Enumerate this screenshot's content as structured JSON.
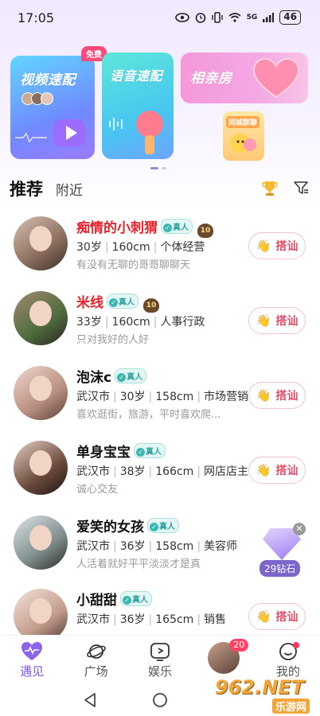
{
  "status_bar": {
    "time": "17:05",
    "signal": "5G",
    "battery": "46"
  },
  "banners": {
    "video_match": {
      "title": "视频速配",
      "badge": "免费"
    },
    "voice_match": {
      "title": "语音速配"
    },
    "blind_date": {
      "title": "相亲房"
    },
    "city_group": {
      "title": "同城群聊"
    }
  },
  "tabs": {
    "recommend": "推荐",
    "nearby": "附近"
  },
  "real_label": "真人",
  "greet_label": "搭讪",
  "users": [
    {
      "name": "痴情的小刺猬",
      "name_red": true,
      "real": true,
      "level": "10",
      "city": "",
      "age": "30岁",
      "height": "160cm",
      "job": "个体经营",
      "bio": "有没有无聊的哥哥聊聊天"
    },
    {
      "name": "米线",
      "name_red": true,
      "real": true,
      "level": "10",
      "city": "",
      "age": "33岁",
      "height": "160cm",
      "job": "人事行政",
      "bio": "只对我好的人好"
    },
    {
      "name": "泡沫c",
      "name_red": false,
      "real": true,
      "level": "",
      "city": "武汉市",
      "age": "30岁",
      "height": "158cm",
      "job": "市场营销",
      "bio": "喜欢逛街，旅游，平时喜欢爬..."
    },
    {
      "name": "单身宝宝",
      "name_red": false,
      "real": true,
      "level": "",
      "city": "武汉市",
      "age": "38岁",
      "height": "166cm",
      "job": "网店店主",
      "bio": "诚心交友"
    },
    {
      "name": "爱笑的女孩",
      "name_red": false,
      "real": true,
      "level": "",
      "city": "武汉市",
      "age": "36岁",
      "height": "158cm",
      "job": "美容师",
      "bio": "人活着就好平平淡淡才是真"
    },
    {
      "name": "小甜甜",
      "name_red": false,
      "real": true,
      "level": "",
      "city": "武汉市",
      "age": "36岁",
      "height": "165cm",
      "job": "销售",
      "bio": ""
    }
  ],
  "reward": {
    "label": "29钻石"
  },
  "bottom_nav": {
    "meet": "遇见",
    "square": "广场",
    "entertainment": "娱乐",
    "messages_badge": "20",
    "me": "我的"
  },
  "watermark": {
    "text": "962.NET",
    "subtext": "乐游网"
  },
  "colors": {
    "accent": "#7e58e6",
    "highlight_name": "#e8232b",
    "greet": "#e0506a"
  }
}
